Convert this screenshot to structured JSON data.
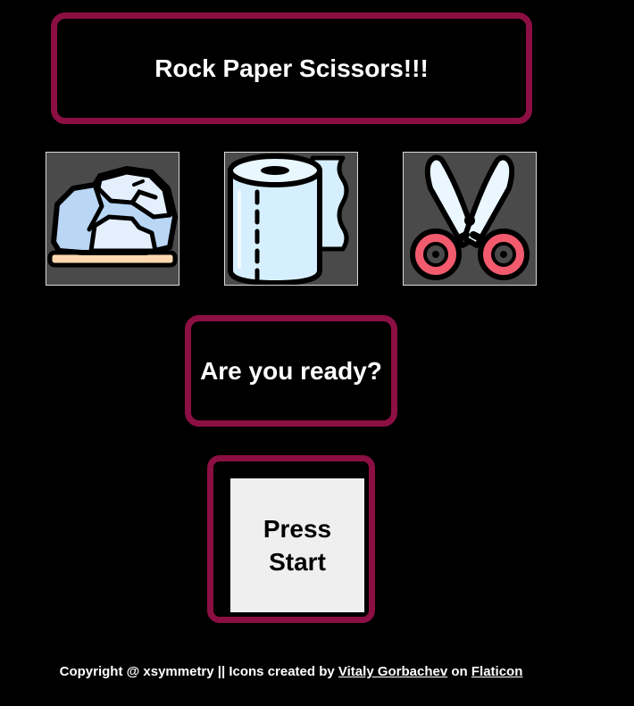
{
  "header": {
    "title": "Rock Paper Scissors!!!"
  },
  "choices": [
    {
      "name": "rock",
      "icon": "rock-icon"
    },
    {
      "name": "paper",
      "icon": "paper-roll-icon"
    },
    {
      "name": "scissors",
      "icon": "scissors-icon"
    }
  ],
  "status": {
    "message": "Are you ready?"
  },
  "start": {
    "line1": "Press",
    "line2": "Start"
  },
  "footer": {
    "prefix": "Copyright @ xsymmetry || Icons created by ",
    "author_link": "Vitaly Gorbachev",
    "middle": " on ",
    "site_link": "Flaticon"
  },
  "colors": {
    "background": "#000000",
    "border_accent": "#8c0f44",
    "text": "#ffffff",
    "button_bg": "#efefef"
  }
}
